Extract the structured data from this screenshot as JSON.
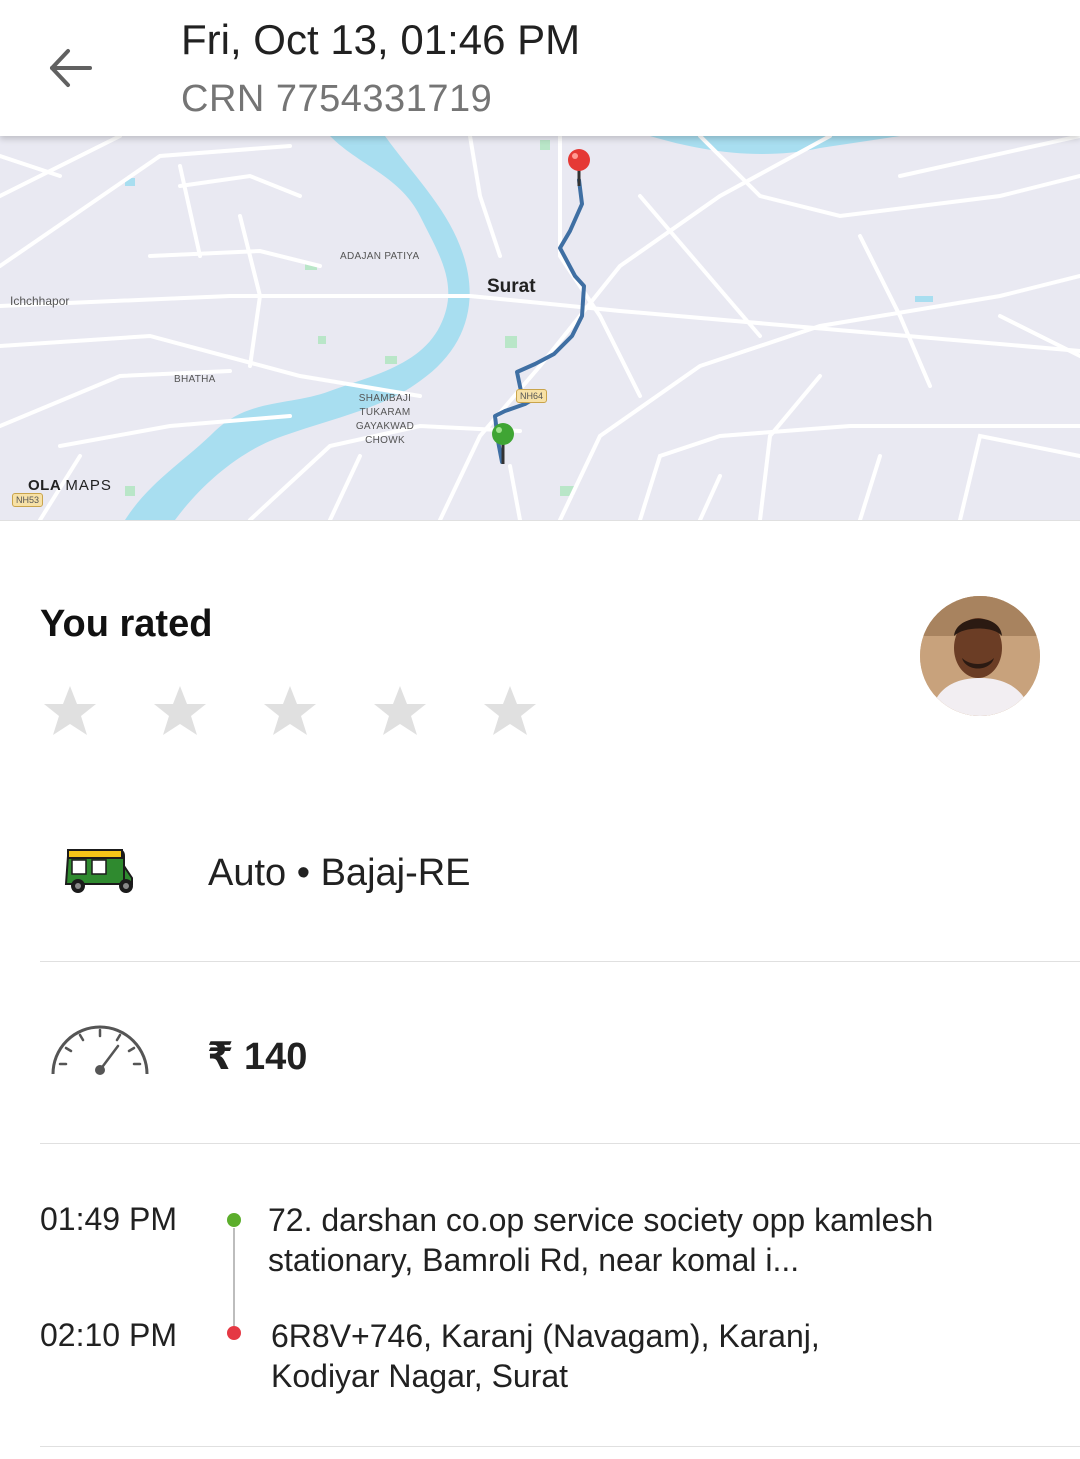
{
  "header": {
    "title": "Fri, Oct 13, 01:46 PM",
    "crn": "CRN 7754331719",
    "back_icon": "arrow-back-icon"
  },
  "map": {
    "city": "Surat",
    "places": [
      "ADAJAN PATIYA",
      "Ichchhapor",
      "BHATHA",
      "SHAMBAJI TUKARAM GAYAKWAD CHOWK"
    ],
    "road_shields": [
      "NH64",
      "NH53"
    ],
    "brand_bold": "OLA",
    "brand_light": "MAPS",
    "route_color": "#3f6fa3",
    "pickup_pin_color": "#3fa534",
    "drop_pin_color": "#e53935"
  },
  "rating": {
    "title": "You rated",
    "stars_total": 5,
    "stars_filled": 0,
    "star_color": "#e0e0e0"
  },
  "vehicle": {
    "icon": "auto-rickshaw-icon",
    "label": "Auto • Bajaj-RE"
  },
  "fare": {
    "icon": "meter-icon",
    "amount": "₹ 140"
  },
  "trip": {
    "pickup": {
      "time": "01:49 PM",
      "address": "72. darshan co.op service society opp kamlesh stationary, Bamroli Rd, near komal i...",
      "dot_color": "#5cae2c"
    },
    "drop": {
      "time": "02:10 PM",
      "address": "6R8V+746, Karanj (Navagam), Karanj, Kodiyar Nagar, Surat",
      "dot_color": "#e53944"
    }
  }
}
